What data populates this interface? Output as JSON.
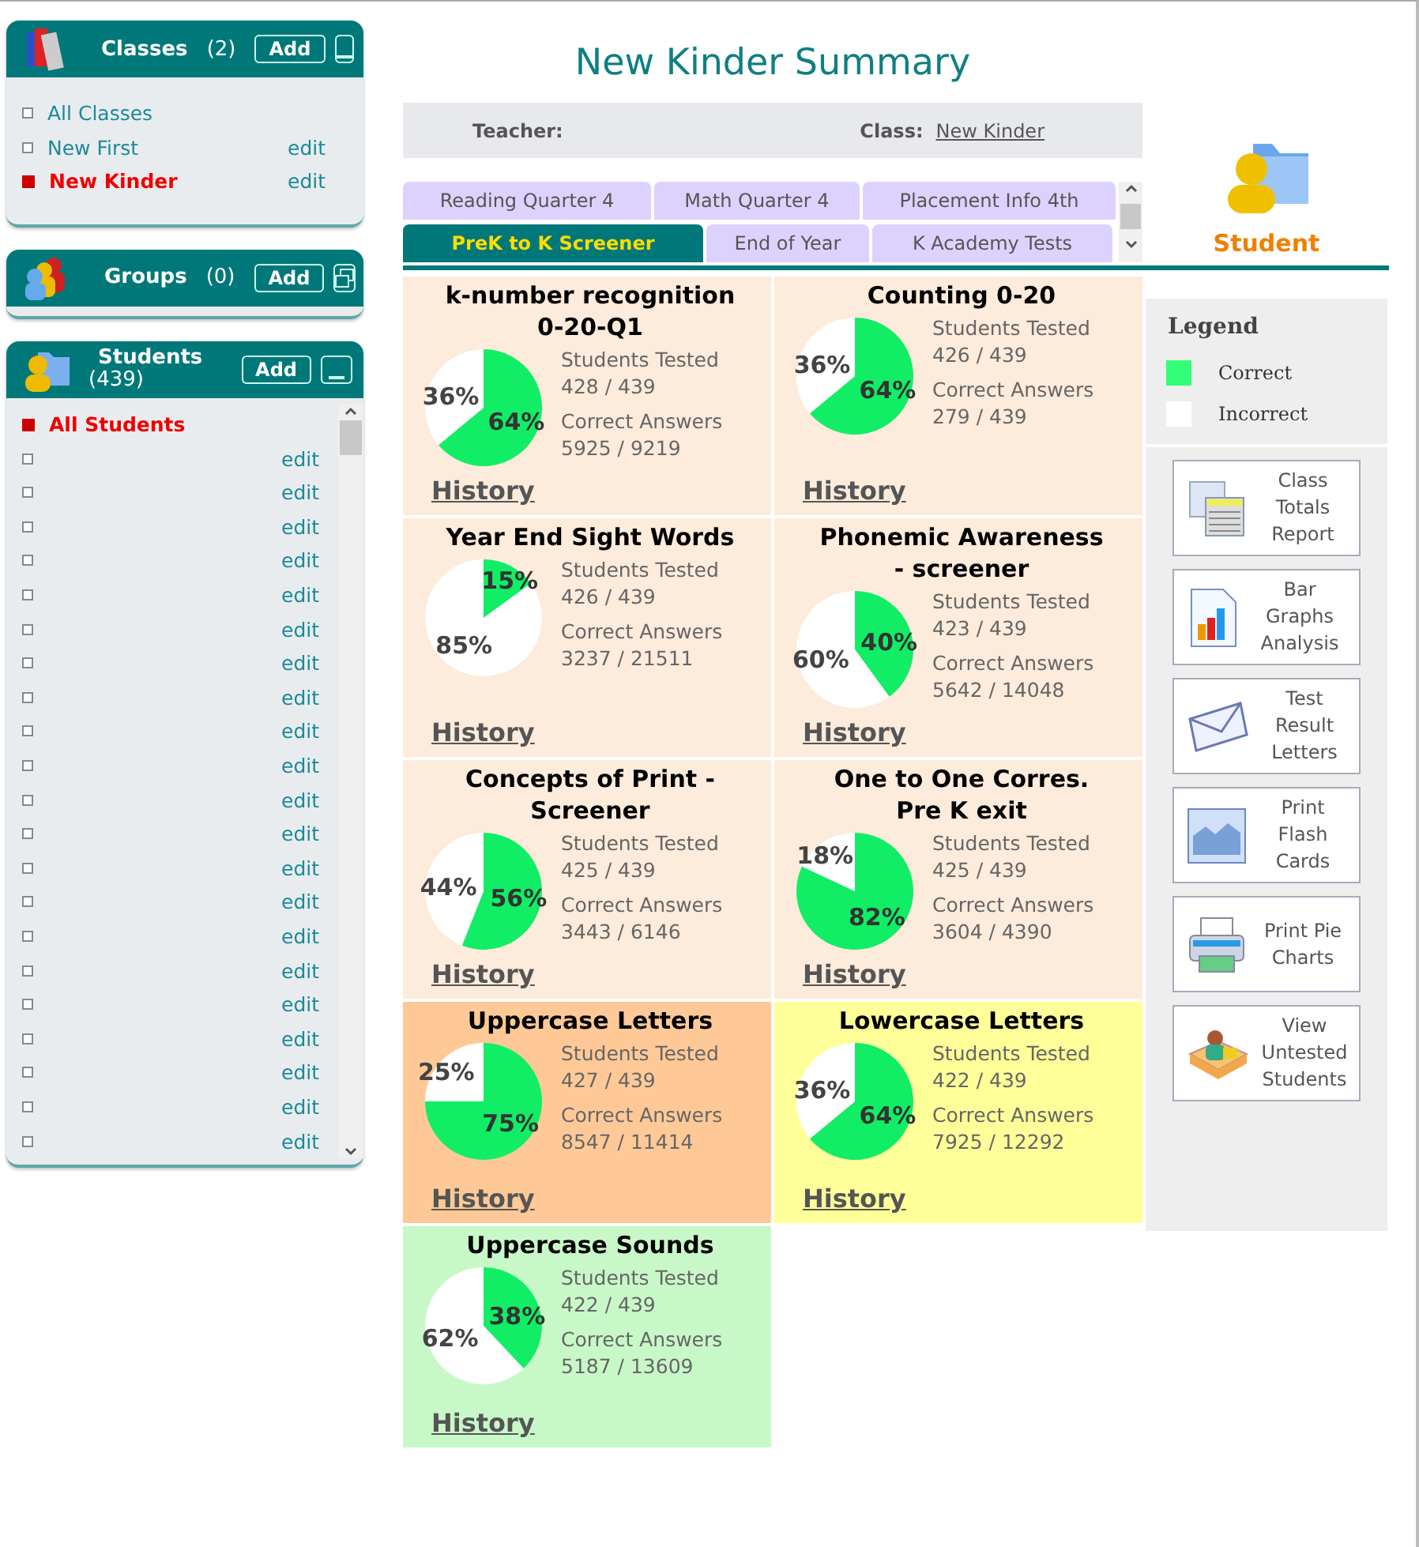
{
  "classes": {
    "title": "Classes",
    "count": "(2)",
    "add_label": "Add",
    "items": [
      {
        "label": "All Classes",
        "selected": false
      },
      {
        "label": "New First",
        "selected": false,
        "edit": "edit"
      },
      {
        "label": "New Kinder",
        "selected": true,
        "edit": "edit"
      }
    ]
  },
  "groups": {
    "title": "Groups",
    "count": "(0)",
    "add_label": "Add"
  },
  "students": {
    "title": "Students",
    "count": "(439)",
    "add_label": "Add",
    "items": [
      {
        "label": "All Students",
        "selected": true
      },
      {
        "selected": false,
        "edit": "edit"
      },
      {
        "selected": false,
        "edit": "edit"
      },
      {
        "selected": false,
        "edit": "edit"
      },
      {
        "selected": false,
        "edit": "edit"
      },
      {
        "selected": false,
        "edit": "edit"
      },
      {
        "selected": false,
        "edit": "edit"
      },
      {
        "selected": false,
        "edit": "edit"
      },
      {
        "selected": false,
        "edit": "edit"
      },
      {
        "selected": false,
        "edit": "edit"
      },
      {
        "selected": false,
        "edit": "edit"
      },
      {
        "selected": false,
        "edit": "edit"
      },
      {
        "selected": false,
        "edit": "edit"
      },
      {
        "selected": false,
        "edit": "edit"
      },
      {
        "selected": false,
        "edit": "edit"
      },
      {
        "selected": false,
        "edit": "edit"
      },
      {
        "selected": false,
        "edit": "edit"
      },
      {
        "selected": false,
        "edit": "edit"
      },
      {
        "selected": false,
        "edit": "edit"
      },
      {
        "selected": false,
        "edit": "edit"
      },
      {
        "selected": false,
        "edit": "edit"
      },
      {
        "selected": false,
        "edit": "edit"
      }
    ]
  },
  "page_title": "New Kinder Summary",
  "info_bar": {
    "teacher_label": "Teacher:",
    "class_label": "Class:",
    "class_value": "New Kinder"
  },
  "tab_rows": [
    [
      {
        "label": "Reading Quarter 4",
        "selected": false
      },
      {
        "label": "Math Quarter 4",
        "selected": false
      },
      {
        "label": "Placement Info 4th",
        "selected": false
      }
    ],
    [
      {
        "label": "PreK to K Screener",
        "selected": true
      },
      {
        "label": "End of Year",
        "selected": false
      },
      {
        "label": "K Academy Tests",
        "selected": false
      }
    ]
  ],
  "student_link": "Student",
  "cards": [
    {
      "title": "k-number recognition 0-20-Q1",
      "color": "#fdebdb",
      "tested_label": "Students Tested",
      "tested": "428 / 439",
      "correct_label": "Correct Answers",
      "correct": "5925 / 9219",
      "history": "History",
      "chart_data": {
        "type": "pie",
        "values": [
          64,
          36
        ],
        "value_labels": [
          "64%",
          "36%"
        ]
      }
    },
    {
      "title": "Counting 0-20",
      "color": "#fdebdb",
      "tested_label": "Students Tested",
      "tested": "426 / 439",
      "correct_label": "Correct Answers",
      "correct": "279 / 439",
      "history": "History",
      "chart_data": {
        "type": "pie",
        "values": [
          64,
          36
        ],
        "value_labels": [
          "64%",
          "36%"
        ]
      }
    },
    {
      "title": "Year End Sight Words",
      "color": "#fdebdb",
      "tested_label": "Students Tested",
      "tested": "426 / 439",
      "correct_label": "Correct Answers",
      "correct": "3237 / 21511",
      "history": "History",
      "chart_data": {
        "type": "pie",
        "values": [
          15,
          85
        ],
        "value_labels": [
          "15%",
          "85%"
        ]
      }
    },
    {
      "title": "Phonemic Awareness - screener",
      "color": "#fdebdb",
      "tested_label": "Students Tested",
      "tested": "423 / 439",
      "correct_label": "Correct Answers",
      "correct": "5642 / 14048",
      "history": "History",
      "chart_data": {
        "type": "pie",
        "values": [
          40,
          60
        ],
        "value_labels": [
          "40%",
          "60%"
        ]
      }
    },
    {
      "title": "Concepts of Print - Screener",
      "color": "#fdebdb",
      "tested_label": "Students Tested",
      "tested": "425 / 439",
      "correct_label": "Correct Answers",
      "correct": "3443 / 6146",
      "history": "History",
      "chart_data": {
        "type": "pie",
        "values": [
          56,
          44
        ],
        "value_labels": [
          "56%",
          "44%"
        ]
      }
    },
    {
      "title": "One to One Corres. Pre K exit",
      "color": "#fdebdb",
      "tested_label": "Students Tested",
      "tested": "425 / 439",
      "correct_label": "Correct Answers",
      "correct": "3604 / 4390",
      "history": "History",
      "chart_data": {
        "type": "pie",
        "values": [
          82,
          18
        ],
        "value_labels": [
          "82%",
          "18%"
        ]
      }
    },
    {
      "title": "Uppercase Letters",
      "color": "#ffc997",
      "tested_label": "Students Tested",
      "tested": "427 / 439",
      "correct_label": "Correct Answers",
      "correct": "8547 / 11414",
      "history": "History",
      "chart_data": {
        "type": "pie",
        "values": [
          75,
          25
        ],
        "value_labels": [
          "75%",
          "25%"
        ]
      }
    },
    {
      "title": "Lowercase Letters",
      "color": "#ffff99",
      "tested_label": "Students Tested",
      "tested": "422 / 439",
      "correct_label": "Correct Answers",
      "correct": "7925 / 12292",
      "history": "History",
      "chart_data": {
        "type": "pie",
        "values": [
          64,
          36
        ],
        "value_labels": [
          "64%",
          "36%"
        ]
      }
    },
    {
      "title": "Uppercase Sounds",
      "color": "#c8f8c8",
      "tested_label": "Students Tested",
      "tested": "422 / 439",
      "correct_label": "Correct Answers",
      "correct": "5187 / 13609",
      "history": "History",
      "chart_data": {
        "type": "pie",
        "values": [
          38,
          62
        ],
        "value_labels": [
          "38%",
          "62%"
        ]
      }
    }
  ],
  "legend": {
    "title": "Legend",
    "items": [
      {
        "label": "Correct",
        "color": "#33ff77"
      },
      {
        "label": "Incorrect",
        "color": "#ffffff"
      }
    ]
  },
  "tools": [
    {
      "kind": "report",
      "label": "Class Totals Report"
    },
    {
      "kind": "bars",
      "label": "Bar Graphs Analysis"
    },
    {
      "kind": "letter",
      "label": "Test Result Letters"
    },
    {
      "kind": "cards",
      "label": "Print Flash Cards"
    },
    {
      "kind": "printer",
      "label": "Print Pie Charts"
    },
    {
      "kind": "untested",
      "label": "View Untested Students"
    }
  ]
}
